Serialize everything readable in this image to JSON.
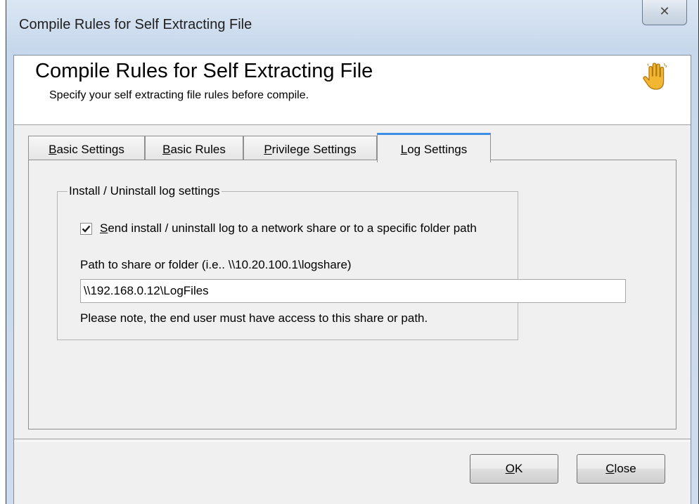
{
  "window": {
    "title": "Compile Rules for Self Extracting File",
    "close_glyph": "✕"
  },
  "header": {
    "title": "Compile Rules for Self Extracting File",
    "subtitle": "Specify your self extracting file rules before compile.",
    "icon": "hand-icon"
  },
  "tabs": [
    {
      "mnemonic": "B",
      "rest": "asic Settings",
      "active": false
    },
    {
      "mnemonic": "B",
      "rest": "asic Rules",
      "active": false
    },
    {
      "mnemonic": "P",
      "rest": "rivilege Settings",
      "active": false
    },
    {
      "mnemonic": "L",
      "rest": "og Settings",
      "active": true
    }
  ],
  "log_settings": {
    "group_title": "Install / Uninstall log settings",
    "checkbox": {
      "checked": true,
      "mnemonic": "S",
      "rest": "end install / uninstall log to a network share or to a specific folder path"
    },
    "path_label": "Path to share or folder (i.e.. \\\\10.20.100.1\\logshare)",
    "path_value": "\\\\192.168.0.12\\LogFiles",
    "note": "Please note, the end user must have access to this share or path."
  },
  "buttons": {
    "ok": {
      "mnemonic": "O",
      "rest": "K"
    },
    "close": {
      "mnemonic": "C",
      "rest": "lose"
    }
  },
  "colors": {
    "active_tab_accent": "#3d8ee6",
    "hand_icon": "#f2b632"
  }
}
